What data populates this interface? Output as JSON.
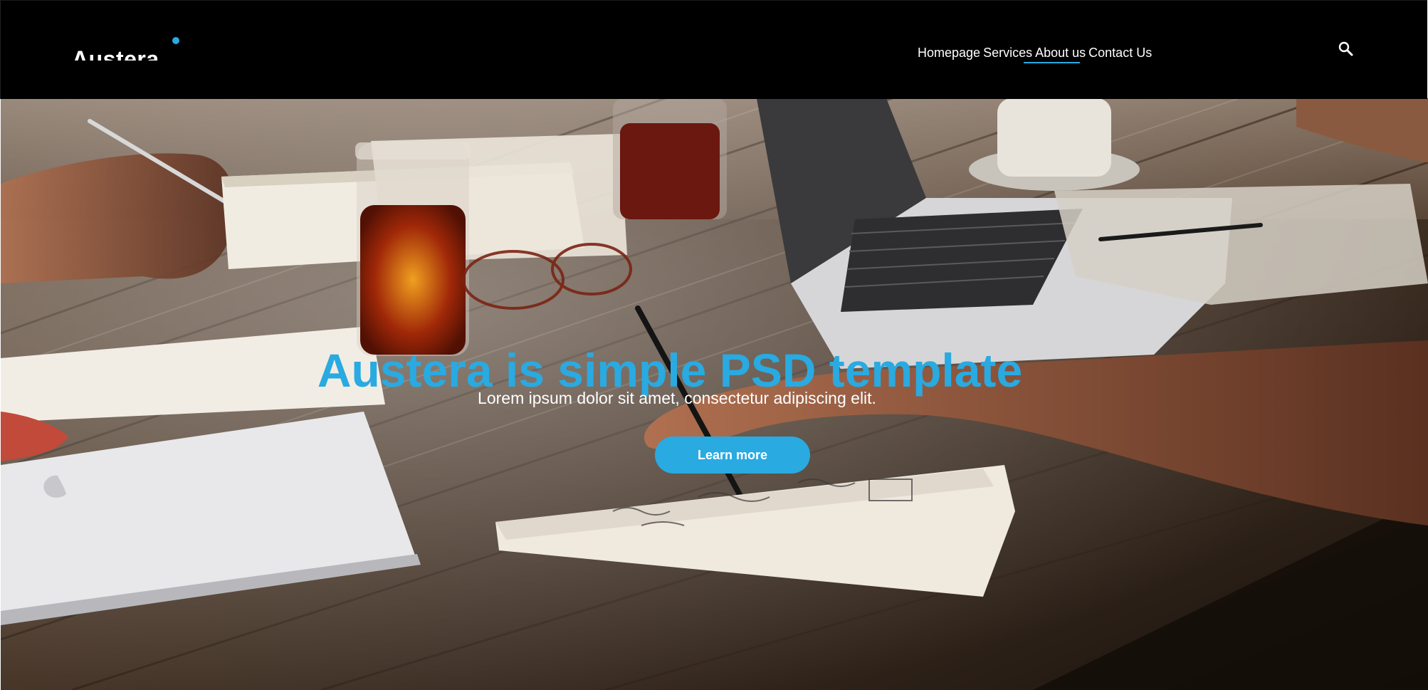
{
  "brand": {
    "name": "Austera",
    "accent_color": "#29aae1"
  },
  "nav": {
    "items": [
      {
        "label": "Homepage"
      },
      {
        "label": "Services"
      },
      {
        "label": "About us",
        "active": true
      },
      {
        "label": "Contact Us"
      }
    ],
    "search_icon": "search-icon"
  },
  "hero": {
    "title": "Austera is simple PSD template",
    "subtitle": "Lorem ipsum dolor sit amet, consectetur adipiscing elit.",
    "cta_label": "Learn more",
    "background": "photo of people working at a wooden table with laptops, notebooks and drinks"
  }
}
